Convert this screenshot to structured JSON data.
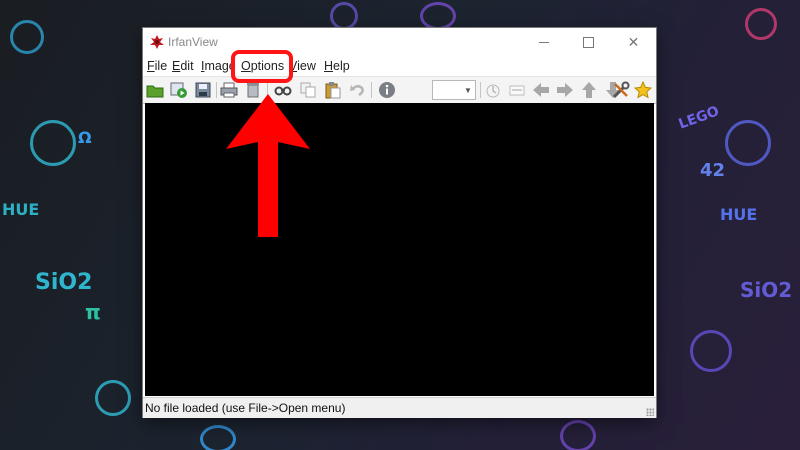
{
  "window": {
    "title": "IrfanView",
    "controls": {
      "minimize": "–",
      "maximize": "☐",
      "close": "✕"
    }
  },
  "menu": {
    "items": [
      {
        "key": "file",
        "label": "File"
      },
      {
        "key": "edit",
        "label": "Edit"
      },
      {
        "key": "image",
        "label": "Image"
      },
      {
        "key": "options",
        "label": "Options"
      },
      {
        "key": "view",
        "label": "View"
      },
      {
        "key": "help",
        "label": "Help"
      }
    ]
  },
  "toolbar": {
    "icons": [
      "open-folder-icon",
      "slideshow-icon",
      "save-icon",
      "print-icon",
      "delete-icon",
      "find-icon",
      "copy-icon",
      "paste-icon",
      "undo-icon",
      "info-icon",
      "zoom-select",
      "lock-icon",
      "scan-icon",
      "arrow-left-icon",
      "arrow-right-icon",
      "arrow-up-icon",
      "arrow-down-icon",
      "settings-icon",
      "favorite-star-icon"
    ],
    "zoom_value": ""
  },
  "status": {
    "text": "No file loaded (use File->Open menu)"
  },
  "annotation": {
    "highlight_color": "#ff1515",
    "arrow_color": "#ff0000"
  },
  "wallpaper": {
    "doodles": [
      "HUE",
      "SiO2",
      "π",
      "42",
      "LEGO",
      "HUE",
      "SiO2",
      "Ω"
    ],
    "accent_colors": [
      "#33c6e0",
      "#3aa8ff",
      "#a04fd6",
      "#ff3c8a",
      "#2fd2b0"
    ]
  }
}
